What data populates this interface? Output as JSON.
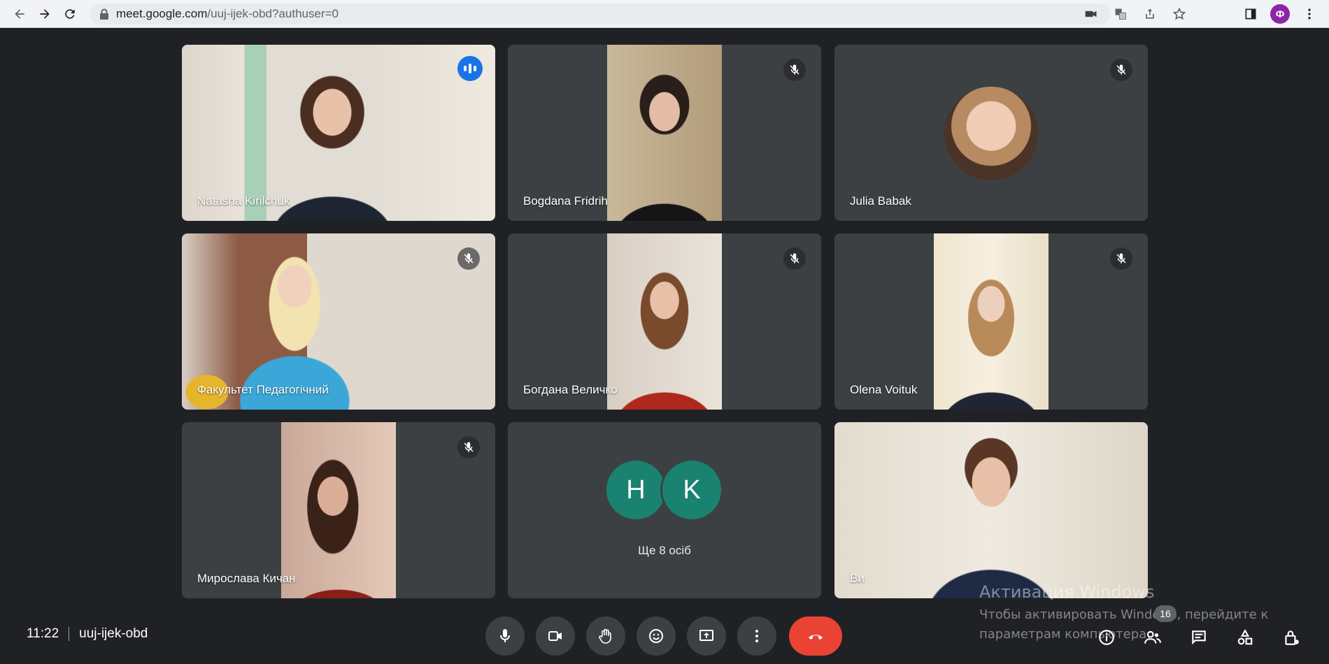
{
  "browser": {
    "url_host": "meet.google.com",
    "url_path": "/uuj-ijek-obd?authuser=0",
    "profile_initial": "Ф"
  },
  "tiles": [
    {
      "name": "Natasha Kirilchuk",
      "speaking": true
    },
    {
      "name": "Bogdana Fridrih",
      "muted": true
    },
    {
      "name": "Julia Babak",
      "muted": true
    },
    {
      "name": "Факультет Педагогічний",
      "muted": true
    },
    {
      "name": "Богдана Величко",
      "muted": true
    },
    {
      "name": "Olena Voituk",
      "muted": true
    },
    {
      "name": "Мирослава Кичан",
      "muted": true
    },
    {
      "name": "Ще 8 осіб",
      "avatars": [
        "H",
        "K"
      ]
    },
    {
      "name": "Ви"
    }
  ],
  "watermark": {
    "title": "Активация Windows",
    "line1": "Чтобы активировать Windows, перейдите к",
    "line2": "параметрам компьютера."
  },
  "bottom": {
    "time": "11:22",
    "meeting_code": "uuj-ijek-obd",
    "participants_count": "16"
  },
  "colors": {
    "background": "#202124",
    "tile": "#3c4043",
    "speaking_outline": "#8ab4f8",
    "end_call": "#ea4335",
    "avatar": "#1a8270"
  }
}
